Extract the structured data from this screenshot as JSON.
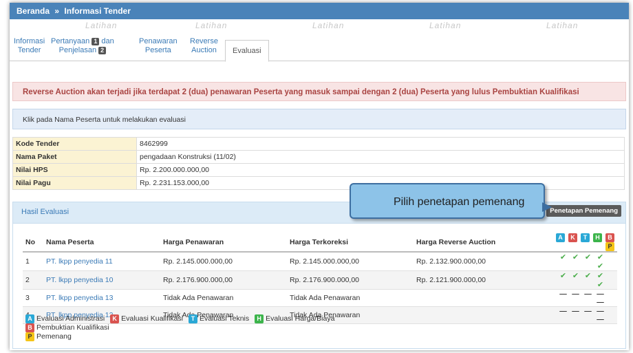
{
  "breadcrumb": {
    "home": "Beranda",
    "sep": "»",
    "current": "Informasi Tender"
  },
  "watermark": "Latihan",
  "tabs": [
    {
      "line1": "Informasi",
      "line2": "Tender"
    },
    {
      "line1": "Pertanyaan",
      "badge1": "1",
      "line1b": "dan",
      "line2": "Penjelasan",
      "badge2": "2"
    },
    {
      "line1": "Penawaran",
      "line2": "Peserta"
    },
    {
      "line1": "Reverse",
      "line2": "Auction"
    },
    {
      "label": "Evaluasi"
    }
  ],
  "alert_warning": "Reverse Auction akan terjadi jika terdapat 2 (dua) penawaran Peserta yang masuk sampai dengan 2 (dua) Peserta yang lulus Pembuktian Kualifikasi",
  "alert_info": "Klik pada Nama Peserta untuk melakukan evaluasi",
  "info": [
    {
      "label": "Kode Tender",
      "value": "8462999"
    },
    {
      "label": "Nama Paket",
      "value": "pengadaan Konstruksi (11/02)"
    },
    {
      "label": "Nilai HPS",
      "value": "Rp. 2.200.000.000,00"
    },
    {
      "label": "Nilai Pagu",
      "value": "Rp. 2.231.153.000,00"
    }
  ],
  "panel": {
    "title": "Hasil Evaluasi",
    "winner_button": "Penetapan Pemenang"
  },
  "callout": "Pilih penetapan pemenang",
  "table": {
    "headers": [
      "No",
      "Nama Peserta",
      "Harga Penawaran",
      "Harga Terkoreksi",
      "Harga Reverse Auction"
    ],
    "status_badges": [
      "A",
      "K",
      "T",
      "H",
      "B",
      "P"
    ],
    "rows": [
      {
        "no": "1",
        "name": "PT. lkpp penyedia 11",
        "offer": "Rp. 2.145.000.000,00",
        "corrected": "Rp. 2.145.000.000,00",
        "auction": "Rp. 2.132.900.000,00",
        "status": "check"
      },
      {
        "no": "2",
        "name": "PT. lkpp penyedia 10",
        "offer": "Rp. 2.176.900.000,00",
        "corrected": "Rp. 2.176.900.000,00",
        "auction": "Rp. 2.121.900.000,00",
        "status": "check"
      },
      {
        "no": "3",
        "name": "PT. lkpp penyedia 13",
        "offer": "Tidak Ada Penawaran",
        "corrected": "Tidak Ada Penawaran",
        "auction": "",
        "status": "dash"
      },
      {
        "no": "4",
        "name": "PT. lkpp penyedia 12",
        "offer": "Tidak Ada Penawaran",
        "corrected": "Tidak Ada Penawaran",
        "auction": "",
        "status": "dash"
      }
    ]
  },
  "legend": [
    {
      "badge": "A",
      "label": "Evaluasi Administrasi"
    },
    {
      "badge": "K",
      "label": "Evaluasi Kualifikasi"
    },
    {
      "badge": "T",
      "label": "Evaluasi Teknis"
    },
    {
      "badge": "H",
      "label": "Evaluasi Harga/Biaya"
    },
    {
      "badge": "B",
      "label": "Pembuktian Kualifikasi"
    },
    {
      "badge": "P",
      "label": "Pemenang"
    }
  ],
  "colors": {
    "A": "#2aa8d6",
    "K": "#d9534f",
    "T": "#2aa8d6",
    "H": "#3cb44b",
    "B": "#d9534f",
    "P": "#f5c518",
    "header_bar": "#4a83b9"
  }
}
